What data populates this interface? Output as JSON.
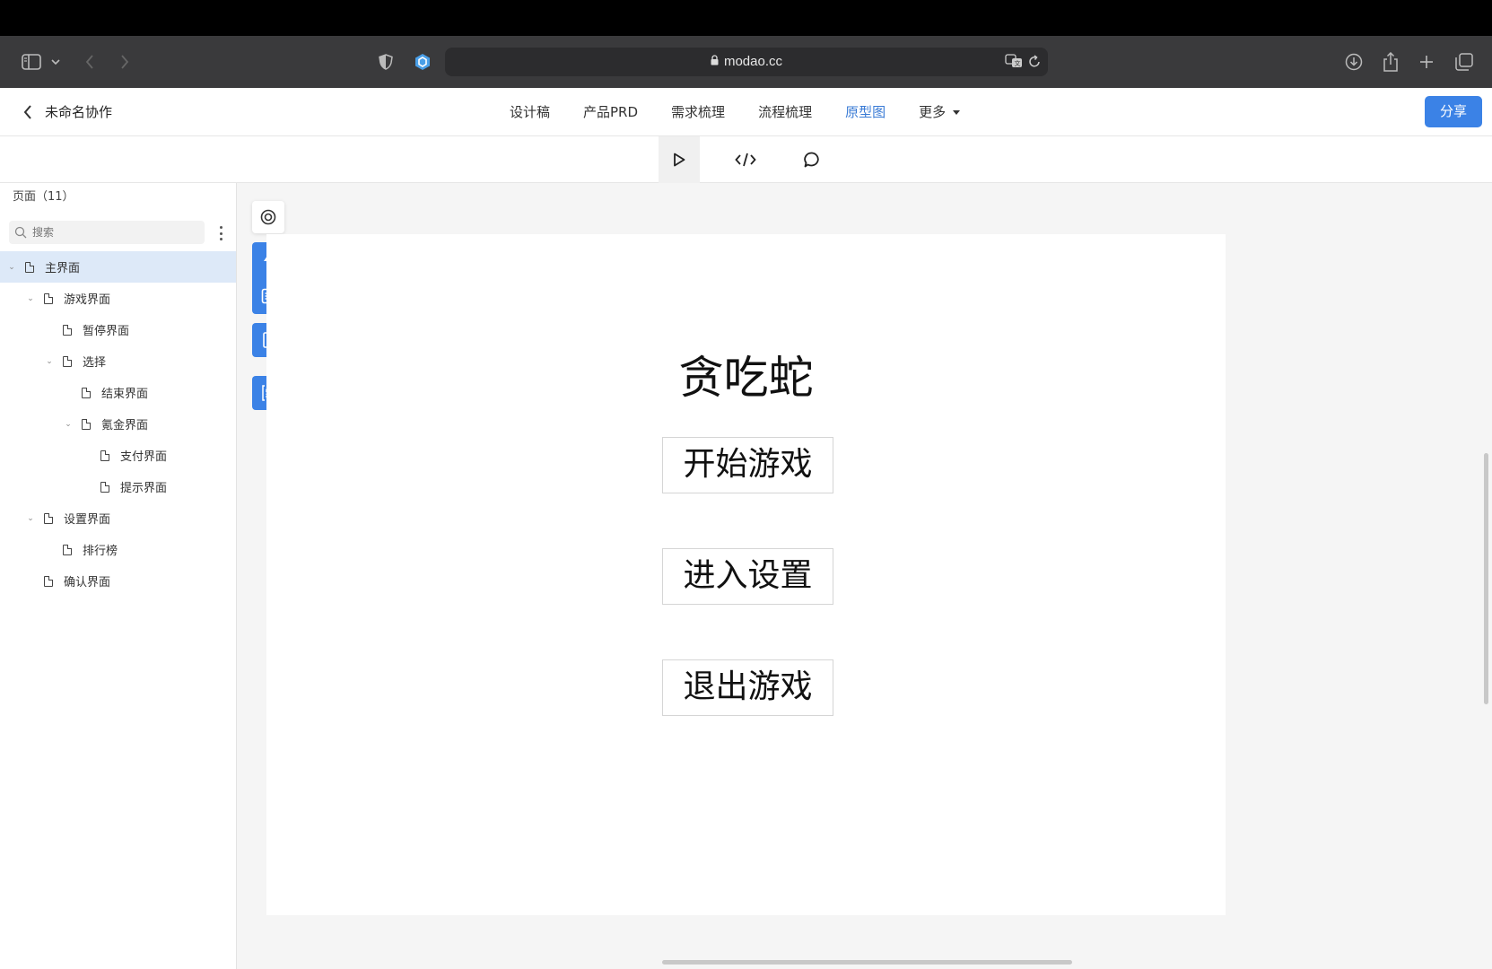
{
  "browser": {
    "url": "modao.cc"
  },
  "app": {
    "doc_title": "未命名协作",
    "tabs": [
      {
        "label": "设计稿"
      },
      {
        "label": "产品PRD"
      },
      {
        "label": "需求梳理"
      },
      {
        "label": "流程梳理"
      },
      {
        "label": "原型图",
        "active": true
      },
      {
        "label": "更多"
      }
    ],
    "share_label": "分享",
    "accent_color": "#3b82e6"
  },
  "toolbar": {
    "tools": [
      "play-icon",
      "code-icon",
      "comment-icon"
    ],
    "selected": "play-icon"
  },
  "sidebar": {
    "header": "页面（11）",
    "search_placeholder": "搜索",
    "pages": [
      {
        "label": "主界面",
        "level": 0,
        "expanded": true,
        "selected": true
      },
      {
        "label": "游戏界面",
        "level": 1,
        "expanded": true
      },
      {
        "label": "暂停界面",
        "level": 2
      },
      {
        "label": "选择",
        "level": 2,
        "expanded": true
      },
      {
        "label": "结束界面",
        "level": 3
      },
      {
        "label": "氪金界面",
        "level": 3,
        "expanded": true
      },
      {
        "label": "支付界面",
        "level": 4
      },
      {
        "label": "提示界面",
        "level": 4
      },
      {
        "label": "设置界面",
        "level": 1,
        "expanded": true
      },
      {
        "label": "排行榜",
        "level": 2
      },
      {
        "label": "确认界面",
        "level": 1
      }
    ]
  },
  "rail": {
    "icons": [
      "target-icon",
      "lightning-icon",
      "document-icon",
      "phone-icon",
      "json-icon"
    ]
  },
  "artboard": {
    "title": "贪吃蛇",
    "buttons": [
      "开始游戏",
      "进入设置",
      "退出游戏"
    ]
  }
}
